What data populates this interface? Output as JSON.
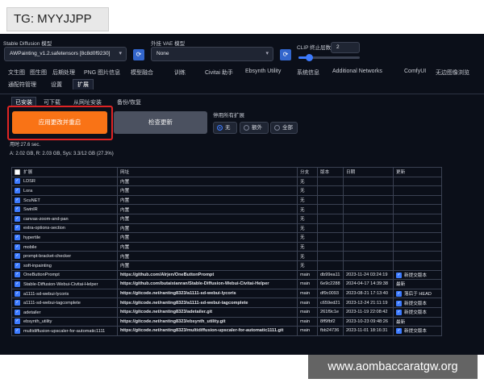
{
  "overlay_tag": "TG: MYYJJPP",
  "watermark": "www.aombaccaratgw.org",
  "model": {
    "sd_label": "Stable Diffusion 模型",
    "sd_value": "AWPainting_v1.2.safetensors [8c8d0f9230]",
    "vae_label": "外挂 VAE 模型",
    "vae_value": "None",
    "clip_label": "CLIP 终止层数",
    "clip_value": "2",
    "clip_fraction": 0.17
  },
  "tabs_row1": [
    "文生图",
    "图生图",
    "后期处理",
    "PNG 图片信息",
    "模型融合",
    "训练",
    "Civitai 助手",
    "Ebsynth Utility",
    "系统信息",
    "Additional Networks",
    "ComfyUI",
    "无边图像浏览"
  ],
  "tabs_row2": [
    "通配符管理",
    "设置",
    "扩展"
  ],
  "subtabs": [
    "已安装",
    "可下载",
    "从网址安装",
    "备份/恢复"
  ],
  "buttons": {
    "apply": "应用更改并重启",
    "check": "检查更新"
  },
  "disable_all": {
    "label": "停用所有扩展",
    "options": [
      "无",
      "额外",
      "全部"
    ],
    "selected": "无"
  },
  "timing": "用时:27.6 sec.",
  "memory": "A: 2.02 GB, R: 2.03 GB, Sys: 3.3/12 GB (27.3%)",
  "table": {
    "headers": [
      "扩展",
      "网址",
      "分支",
      "版本",
      "日期",
      "更新"
    ],
    "rows": [
      {
        "name": "LDSR",
        "url": "内置",
        "branch": "无",
        "version": "",
        "date": "",
        "update": "",
        "checked": true
      },
      {
        "name": "Lora",
        "url": "内置",
        "branch": "无",
        "version": "",
        "date": "",
        "update": "",
        "checked": true
      },
      {
        "name": "ScuNET",
        "url": "内置",
        "branch": "无",
        "version": "",
        "date": "",
        "update": "",
        "checked": true
      },
      {
        "name": "SwinIR",
        "url": "内置",
        "branch": "无",
        "version": "",
        "date": "",
        "update": "",
        "checked": true
      },
      {
        "name": "canvas-zoom-and-pan",
        "url": "内置",
        "branch": "无",
        "version": "",
        "date": "",
        "update": "",
        "checked": true
      },
      {
        "name": "extra-options-section",
        "url": "内置",
        "branch": "无",
        "version": "",
        "date": "",
        "update": "",
        "checked": true
      },
      {
        "name": "hypertile",
        "url": "内置",
        "branch": "无",
        "version": "",
        "date": "",
        "update": "",
        "checked": true
      },
      {
        "name": "mobile",
        "url": "内置",
        "branch": "无",
        "version": "",
        "date": "",
        "update": "",
        "checked": true
      },
      {
        "name": "prompt-bracket-checker",
        "url": "内置",
        "branch": "无",
        "version": "",
        "date": "",
        "update": "",
        "checked": true
      },
      {
        "name": "soft-inpainting",
        "url": "内置",
        "branch": "无",
        "version": "",
        "date": "",
        "update": "",
        "checked": true
      },
      {
        "name": "OneButtonPrompt",
        "url": "https://github.com/AIrjen/OneButtonPrompt",
        "branch": "main",
        "version": "db99ea11",
        "date": "2023-11-24 03:24:19",
        "update": "新提交版本",
        "checked": true,
        "update_checked": true
      },
      {
        "name": "Stable-Diffusion-Webui-Civitai-Helper",
        "url": "https://github.com/butaixianran/Stable-Diffusion-Webui-Civitai-Helper",
        "branch": "main",
        "version": "6e9c2288",
        "date": "2024-04-17 14:39:38",
        "update": "最新",
        "checked": true,
        "update_checked": false
      },
      {
        "name": "a1111-sd-webui-lycoris",
        "url": "https://gitcode.net/ranting8323/a1111-sd-webui-lycoris",
        "branch": "main",
        "version": "df9c0093",
        "date": "2023-08-21 17:13:40",
        "update": "落后于 HEAD",
        "checked": true,
        "update_checked": true
      },
      {
        "name": "a1111-sd-webui-tagcomplete",
        "url": "https://gitcode.net/ranting8323/a1111-sd-webui-tagcomplete",
        "branch": "main",
        "version": "c659ed21",
        "date": "2023-12-24 21:11:19",
        "update": "新提交版本",
        "checked": true,
        "update_checked": true
      },
      {
        "name": "adetailer",
        "url": "https://gitcode.net/ranting8323/adetailer.git",
        "branch": "main",
        "version": "261f9c1e",
        "date": "2023-11-19 22:08:42",
        "update": "新提交版本",
        "checked": true,
        "update_checked": true
      },
      {
        "name": "ebsynth_utility",
        "url": "https://gitcode.net/ranting8323/ebsynth_utility.git",
        "branch": "main",
        "version": "8ff9fbf2",
        "date": "2023-10-23 09:48:26",
        "update": "最新",
        "checked": true,
        "update_checked": false
      },
      {
        "name": "multidiffusion-upscaler-for-automatic1111",
        "url": "https://gitcode.net/ranting8323/multidiffusion-upscaler-for-automatic1111.git",
        "branch": "main",
        "version": "fbb24736",
        "date": "2023-11-01 18:16:31",
        "update": "新提交版本",
        "checked": true,
        "update_checked": true
      }
    ]
  }
}
